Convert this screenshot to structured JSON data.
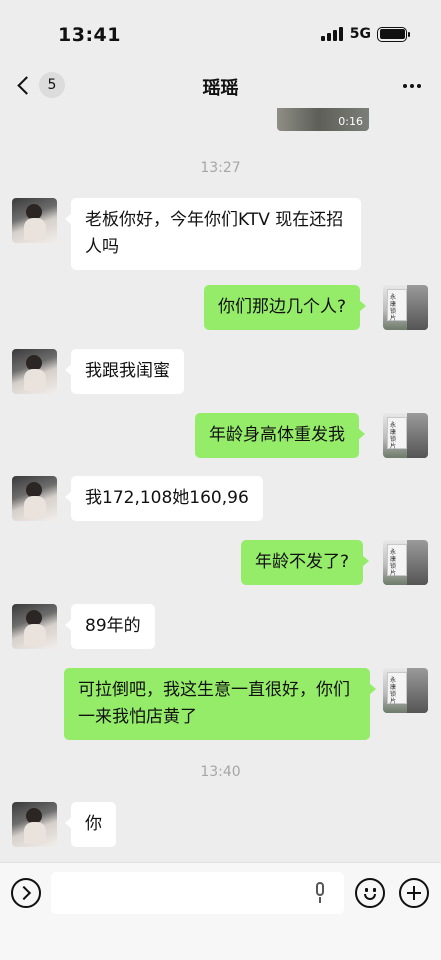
{
  "status_bar": {
    "time": "13:41",
    "network": "5G"
  },
  "header": {
    "back_count": "5",
    "title": "瑶瑶"
  },
  "video": {
    "duration": "0:16"
  },
  "timestamps": [
    "13:27",
    "13:40"
  ],
  "avatar_me": {
    "sign_text": "永康锁片"
  },
  "messages": [
    {
      "sender": "other",
      "text": "老板你好，今年你们KTV 现在还招人吗"
    },
    {
      "sender": "me",
      "text": "你们那边几个人?"
    },
    {
      "sender": "other",
      "text": "我跟我闺蜜"
    },
    {
      "sender": "me",
      "text": "年龄身高体重发我"
    },
    {
      "sender": "other",
      "text": "我172,108她160,96"
    },
    {
      "sender": "me",
      "text": "年龄不发了?"
    },
    {
      "sender": "other",
      "text": "89年的"
    },
    {
      "sender": "me",
      "text": "可拉倒吧，我这生意一直很好，你们一来我怕店黄了"
    },
    {
      "sender": "other",
      "text": "你"
    }
  ],
  "input": {
    "placeholder": "",
    "value": ""
  },
  "colors": {
    "background": "#ededed",
    "outgoing_bubble": "#95ec69",
    "incoming_bubble": "#ffffff"
  }
}
